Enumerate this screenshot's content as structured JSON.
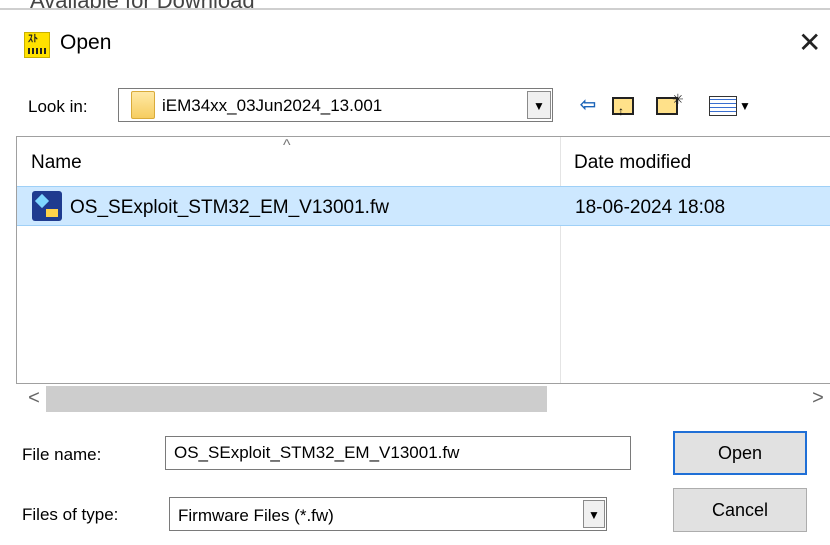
{
  "window": {
    "cutoff_text": "Available for Download",
    "title": "Open",
    "close_glyph": "✕"
  },
  "lookin": {
    "label": "Look in:",
    "value": "iEM34xx_03Jun2024_13.001",
    "toolbar": {
      "back_icon": "back-arrow-icon",
      "up_icon": "up-folder-icon",
      "new_folder_icon": "new-folder-icon",
      "view_icon": "view-menu-icon"
    }
  },
  "file_list": {
    "columns": [
      "Name",
      "Date modified"
    ],
    "rows": [
      {
        "name": "OS_SExploit_STM32_EM_V13001.fw",
        "date_modified": "18-06-2024 18:08",
        "selected": true
      }
    ]
  },
  "scrollbar": {
    "left_glyph": "<",
    "right_glyph": ">"
  },
  "file_name": {
    "label": "File name:",
    "value": "OS_SExploit_STM32_EM_V13001.fw"
  },
  "file_type": {
    "label": "Files of type:",
    "value": "Firmware Files (*.fw)"
  },
  "buttons": {
    "open": "Open",
    "cancel": "Cancel"
  },
  "colors": {
    "selection": "#cde8ff",
    "accent": "#1f6fd6"
  }
}
